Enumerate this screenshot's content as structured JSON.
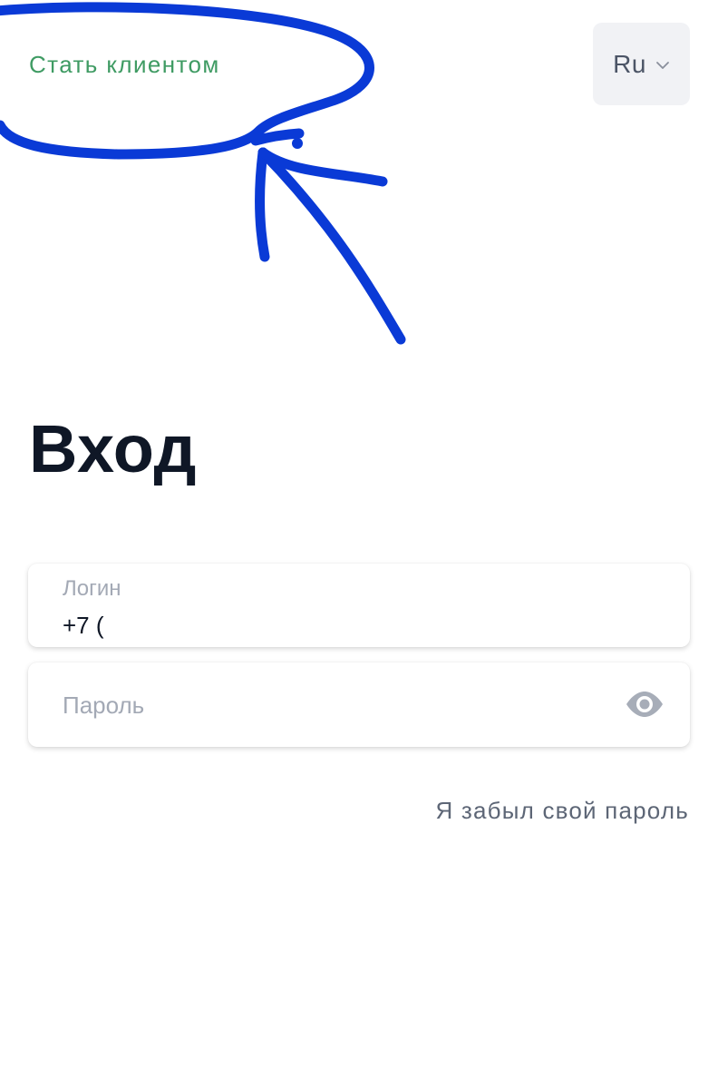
{
  "header": {
    "become_client_label": "Стать клиентом",
    "language": {
      "selected": "Ru",
      "icon": "chevron-down-icon"
    }
  },
  "login_form": {
    "title": "Вход",
    "login_field": {
      "label": "Логин",
      "value": "+7 ("
    },
    "password_field": {
      "placeholder": "Пароль",
      "value": "",
      "icon": "eye-icon"
    },
    "forgot_password_label": "Я забыл свой пароль"
  },
  "colors": {
    "accent_green": "#3f9b63",
    "annotation_blue": "#0a3ad6",
    "title": "#0f1726",
    "muted_text": "#a3a9b5",
    "link_text": "#5d6676",
    "lang_bg": "#f1f2f5"
  }
}
